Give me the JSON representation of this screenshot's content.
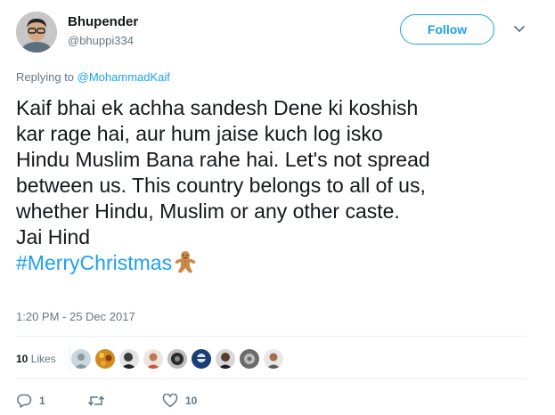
{
  "user": {
    "name": "Bhupender",
    "handle": "@bhuppi334",
    "follow_label": "Follow"
  },
  "reply": {
    "prefix": "Replying to ",
    "mention": "@MohammadKaif"
  },
  "tweet": {
    "lines": [
      "Kaif bhai ek achha sandesh Dene ki koshish",
      "kar rage hai, aur hum jaise kuch log isko",
      "Hindu Muslim Bana rahe hai. Let's not spread",
      "between us. This country belongs to all of us,",
      "whether Hindu, Muslim or any other caste.",
      "Jai Hind"
    ],
    "hashtag": "#MerryChristmas",
    "emoji": "gingerbread-man-icon"
  },
  "timestamp": "1:20 PM - 25 Dec 2017",
  "likes": {
    "count": "10",
    "label": " Likes"
  },
  "liker_avatars": 9,
  "actions": {
    "reply_count": "1",
    "like_count": "10"
  },
  "colors": {
    "accent": "#1da1f2",
    "muted": "#657786",
    "text": "#14171a",
    "divider": "#e6ecf0"
  }
}
